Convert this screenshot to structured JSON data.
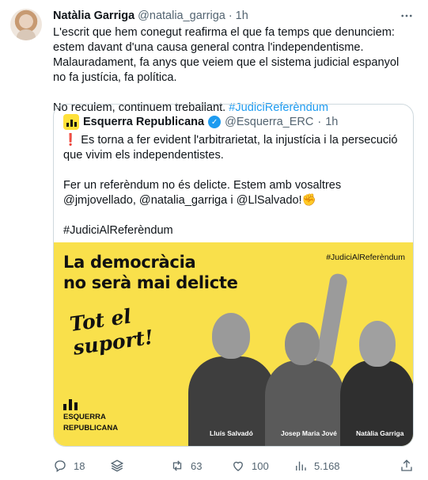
{
  "author": {
    "name": "Natàlia Garriga",
    "handle": "@natalia_garriga",
    "separator": "·",
    "time": "1h"
  },
  "more_icon": "more-horizontal-icon",
  "body": {
    "paragraph1": "L'escrit que hem conegut reafirma el que fa temps que denunciem: estem davant d'una causa general contra l'independentisme. Malauradament, fa anys que veiem que el sistema judicial espanyol no fa justícia, fa política.",
    "paragraph2_text": "No reculem, continuem treballant.",
    "paragraph2_hashtag": "#JudiciReferèndum"
  },
  "quote": {
    "name": "Esquerra Republicana",
    "handle": "@Esquerra_ERC",
    "separator": "·",
    "time": "1h",
    "line1_mark": "❗",
    "line1": "Es torna a fer evident l'arbitrarietat, la injustícia i la persecució que vivim els independentistes.",
    "line2": "Fer un referèndum no és delicte. Estem amb vosaltres @jmjovellado, @natalia_garriga i @LlSalvado!✊",
    "line3": "#JudiciAlReferèndum"
  },
  "poster": {
    "headline_line1": "La democràcia",
    "headline_line2": "no serà mai delicte",
    "tag": "#JudiciAlReferèndum",
    "script_line1": "Tot el",
    "script_line2": "suport!",
    "logo_line1": "ESQUERRA",
    "logo_line2": "REPUBLICANA",
    "people": [
      "Lluís Salvadó",
      "Josep Maria Jové",
      "Natàlia Garriga"
    ],
    "background": "#f9e04b"
  },
  "actions": {
    "replies": "18",
    "retweets": "63",
    "likes": "100",
    "views": "5.168"
  },
  "colors": {
    "link": "#1d9bf0",
    "muted": "#536471",
    "border": "#cfd9de"
  }
}
